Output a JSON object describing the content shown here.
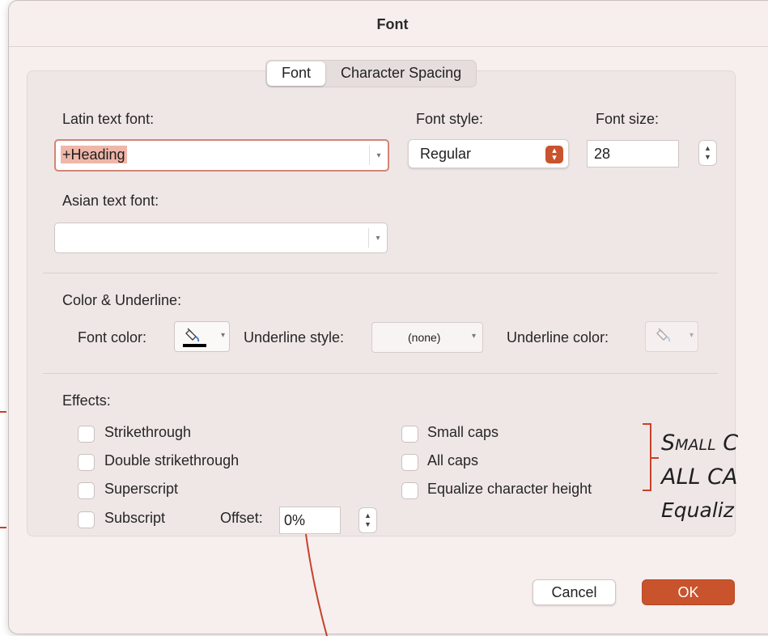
{
  "dialog": {
    "title": "Font"
  },
  "tabs": [
    {
      "label": "Font",
      "active": true
    },
    {
      "label": "Character Spacing",
      "active": false
    }
  ],
  "latin_font": {
    "label": "Latin text font:",
    "value": "+Heading"
  },
  "font_style": {
    "label": "Font style:",
    "value": "Regular"
  },
  "font_size": {
    "label": "Font size:",
    "value": "28"
  },
  "asian_font": {
    "label": "Asian text font:",
    "value": ""
  },
  "color_underline": {
    "heading": "Color & Underline:",
    "font_color_label": "Font color:",
    "font_color": "#000000",
    "underline_style_label": "Underline style:",
    "underline_style_value": "(none)",
    "underline_color_label": "Underline color:"
  },
  "effects": {
    "heading": "Effects:",
    "left": [
      {
        "label": "Strikethrough",
        "checked": false
      },
      {
        "label": "Double strikethrough",
        "checked": false
      },
      {
        "label": "Superscript",
        "checked": false
      },
      {
        "label": "Subscript",
        "checked": false
      }
    ],
    "right": [
      {
        "label": "Small caps",
        "checked": false
      },
      {
        "label": "All caps",
        "checked": false
      },
      {
        "label": "Equalize character height",
        "checked": false
      }
    ],
    "offset_label": "Offset:",
    "offset_value": "0%"
  },
  "buttons": {
    "cancel": "Cancel",
    "ok": "OK"
  },
  "annotations": {
    "lines": [
      "Small C",
      "ALL CA",
      "Equaliz"
    ],
    "color": "#c8402a"
  },
  "colors": {
    "accent": "#c8532c",
    "latin_highlight": "#efb6a9"
  }
}
